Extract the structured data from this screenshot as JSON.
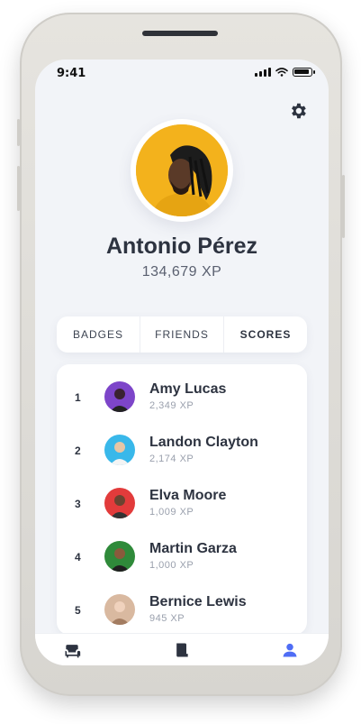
{
  "status_bar": {
    "time": "9:41",
    "signal_icon": "signal-bars-icon",
    "wifi_icon": "wifi-icon",
    "battery_icon": "battery-icon"
  },
  "header": {
    "settings_icon": "gear-icon"
  },
  "profile": {
    "name": "Antonio Pérez",
    "xp": "134,679 XP",
    "avatar_bg": "#f3b21c"
  },
  "tabs": [
    {
      "label": "BADGES",
      "active": false
    },
    {
      "label": "FRIENDS",
      "active": false
    },
    {
      "label": "SCORES",
      "active": true
    }
  ],
  "leaderboard": [
    {
      "rank": "1",
      "name": "Amy Lucas",
      "xp": "2,349 XP",
      "avatar_bg": "#7d45c9"
    },
    {
      "rank": "2",
      "name": "Landon Clayton",
      "xp": "2,174 XP",
      "avatar_bg": "#39b8ea"
    },
    {
      "rank": "3",
      "name": "Elva Moore",
      "xp": "1,009 XP",
      "avatar_bg": "#e23b3b"
    },
    {
      "rank": "4",
      "name": "Martin Garza",
      "xp": "1,000 XP",
      "avatar_bg": "#2f8a3a"
    },
    {
      "rank": "5",
      "name": "Bernice Lewis",
      "xp": "945 XP",
      "avatar_bg": "#d9b9a0"
    }
  ],
  "bottom_nav": [
    {
      "icon": "armchair-icon",
      "active": false
    },
    {
      "icon": "book-icon",
      "active": false
    },
    {
      "icon": "user-icon",
      "active": true
    }
  ],
  "colors": {
    "accent": "#4f6df5",
    "text_primary": "#2d3340",
    "text_muted": "#9aa0ad",
    "background": "#f2f4f8"
  }
}
